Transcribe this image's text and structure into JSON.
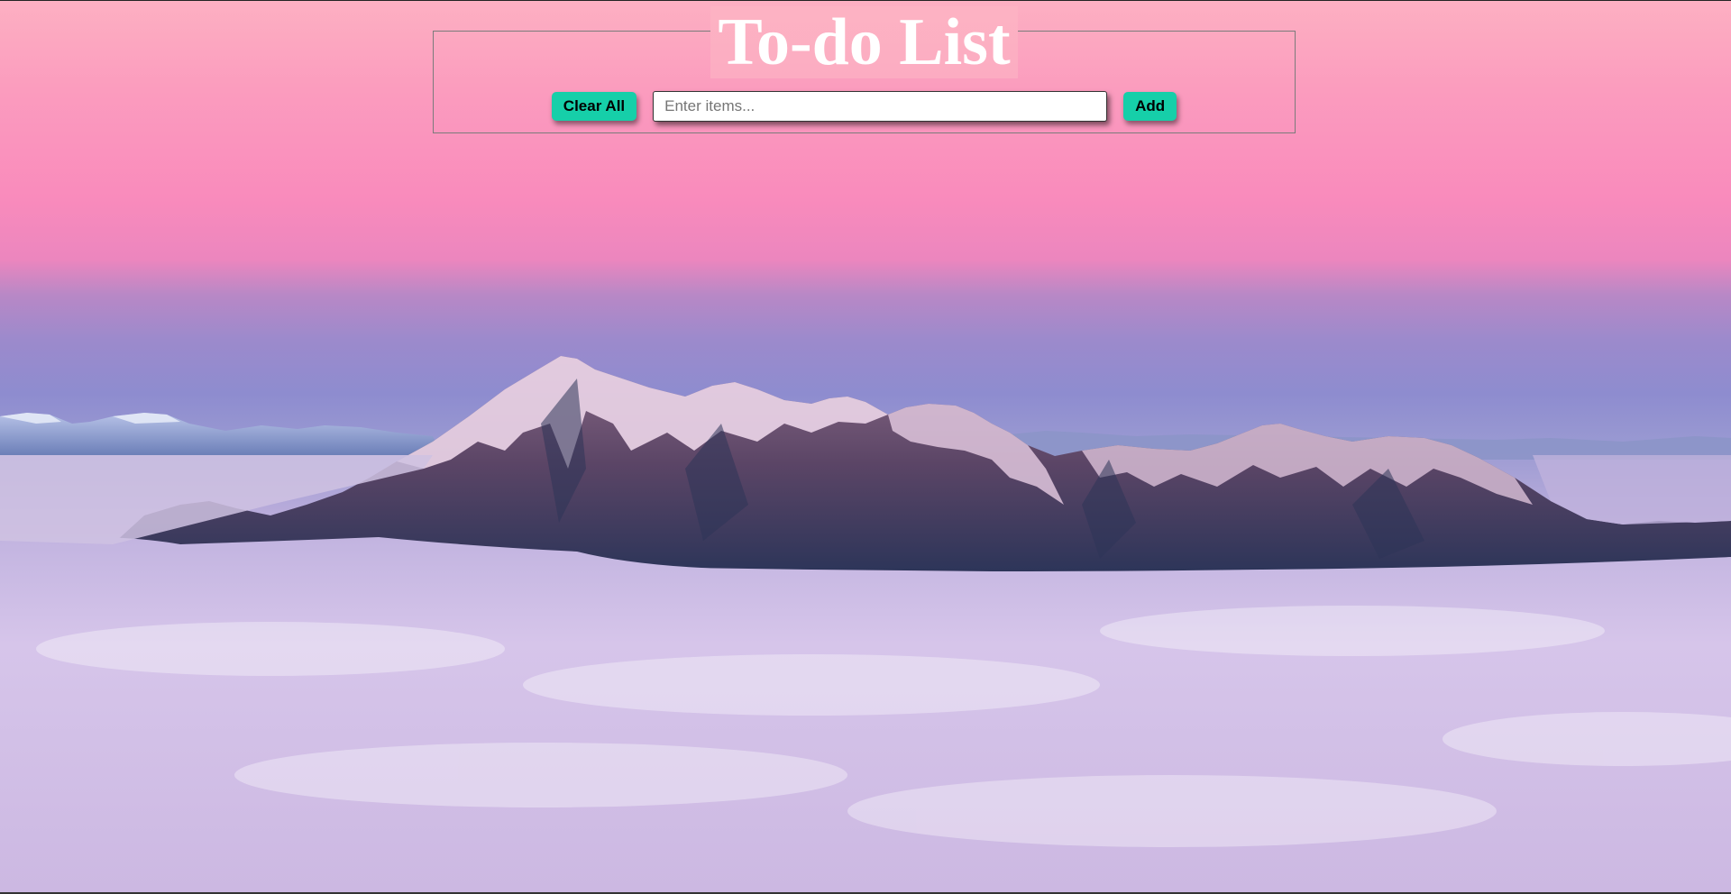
{
  "app": {
    "title": "To-do List"
  },
  "controls": {
    "clear_label": "Clear All",
    "input_value": "",
    "input_placeholder": "Enter items...",
    "add_label": "Add"
  },
  "colors": {
    "button_accent": "#16cfa9",
    "title_text": "#ffffff",
    "sky_top": "#fdb0c2",
    "sky_mid": "#f98bbc",
    "horizon": "#8e8ccf",
    "clouds": "#ddc9ec"
  }
}
